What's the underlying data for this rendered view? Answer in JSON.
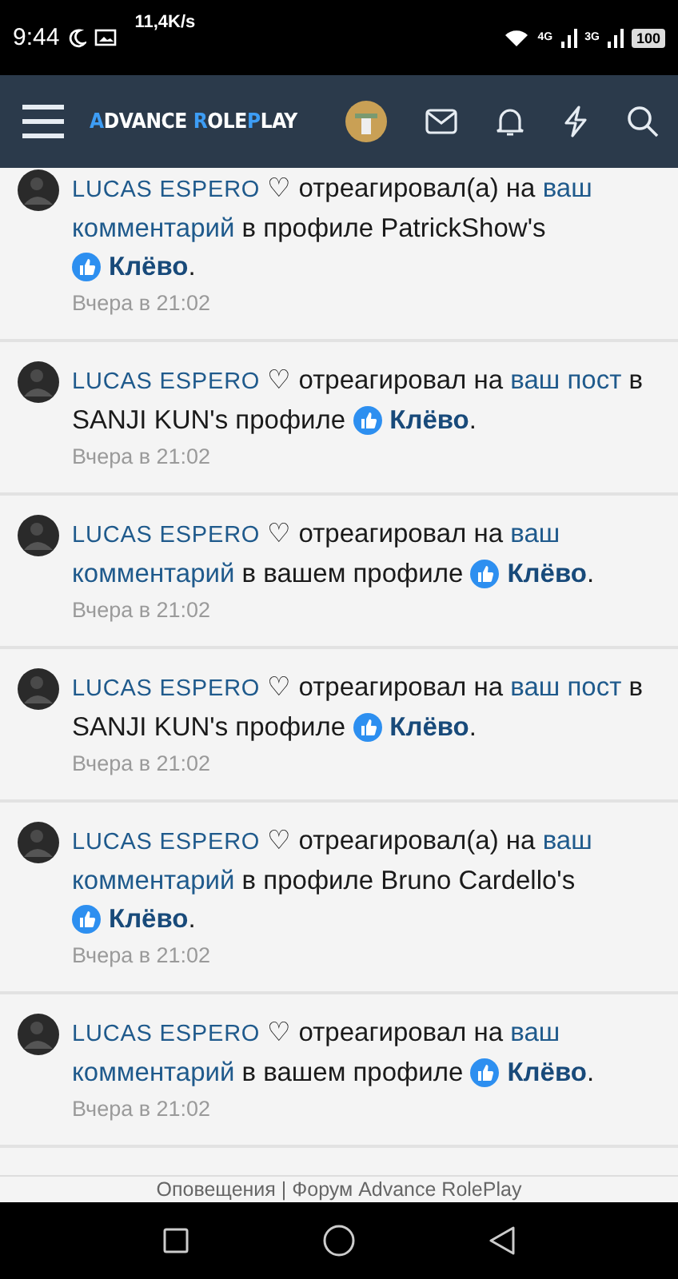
{
  "status_bar": {
    "time": "9:44",
    "speed": "11,4K/s",
    "network_1": "4G",
    "network_2": "3G",
    "battery": "100"
  },
  "header": {
    "logo": [
      {
        "text": "A",
        "accent": true
      },
      {
        "text": "DVANCE ",
        "accent": false
      },
      {
        "text": "R",
        "accent": true
      },
      {
        "text": "OLE",
        "accent": false
      },
      {
        "text": "P",
        "accent": true
      },
      {
        "text": "LAY",
        "accent": false
      }
    ]
  },
  "notifications": [
    {
      "user": "LUCAS ESPERO",
      "parts": [
        {
          "kind": "text",
          "text": "♡ отреагировал(а) на "
        },
        {
          "kind": "link",
          "text": "ваш"
        },
        {
          "kind": "link",
          "text": "комментарий"
        },
        {
          "kind": "text",
          "text": " в профиле PatrickShow's "
        },
        {
          "kind": "reaction",
          "text": "Клёво"
        },
        {
          "kind": "text",
          "text": "."
        }
      ],
      "time": "Вчера в 21:02"
    },
    {
      "user": "LUCAS ESPERO",
      "parts": [
        {
          "kind": "text",
          "text": "♡ отреагировал на "
        },
        {
          "kind": "link",
          "text": "ваш пост"
        },
        {
          "kind": "text",
          "text": " в SANJI KUN's профиле "
        },
        {
          "kind": "reaction",
          "text": "Клёво"
        },
        {
          "kind": "text",
          "text": "."
        }
      ],
      "time": "Вчера в 21:02"
    },
    {
      "user": "LUCAS ESPERO",
      "parts": [
        {
          "kind": "text",
          "text": "♡ отреагировал на "
        },
        {
          "kind": "link",
          "text": "ваш"
        },
        {
          "kind": "link",
          "text": "комментарий"
        },
        {
          "kind": "text",
          "text": " в вашем профиле "
        },
        {
          "kind": "reaction",
          "text": "Клёво"
        },
        {
          "kind": "text",
          "text": "."
        }
      ],
      "time": "Вчера в 21:02"
    },
    {
      "user": "LUCAS ESPERO",
      "parts": [
        {
          "kind": "text",
          "text": "♡ отреагировал на "
        },
        {
          "kind": "link",
          "text": "ваш пост"
        },
        {
          "kind": "text",
          "text": " в SANJI KUN's профиле "
        },
        {
          "kind": "reaction",
          "text": "Клёво"
        },
        {
          "kind": "text",
          "text": "."
        }
      ],
      "time": "Вчера в 21:02"
    },
    {
      "user": "LUCAS ESPERO",
      "parts": [
        {
          "kind": "text",
          "text": "♡ отреагировал(а) на "
        },
        {
          "kind": "link",
          "text": "ваш"
        },
        {
          "kind": "link",
          "text": "комментарий"
        },
        {
          "kind": "text",
          "text": " в профиле Bruno Cardello's "
        },
        {
          "kind": "reaction",
          "text": "Клёво"
        },
        {
          "kind": "text",
          "text": "."
        }
      ],
      "time": "Вчера в 21:02"
    },
    {
      "user": "LUCAS ESPERO",
      "parts": [
        {
          "kind": "text",
          "text": "♡ отреагировал на "
        },
        {
          "kind": "link",
          "text": "ваш"
        },
        {
          "kind": "link",
          "text": "комментарий"
        },
        {
          "kind": "text",
          "text": " в вашем профиле "
        },
        {
          "kind": "reaction",
          "text": "Клёво"
        },
        {
          "kind": "text",
          "text": "."
        }
      ],
      "time": "Вчера в 21:02"
    }
  ],
  "page_title": "Оповещения | Форум Advance RolePlay"
}
